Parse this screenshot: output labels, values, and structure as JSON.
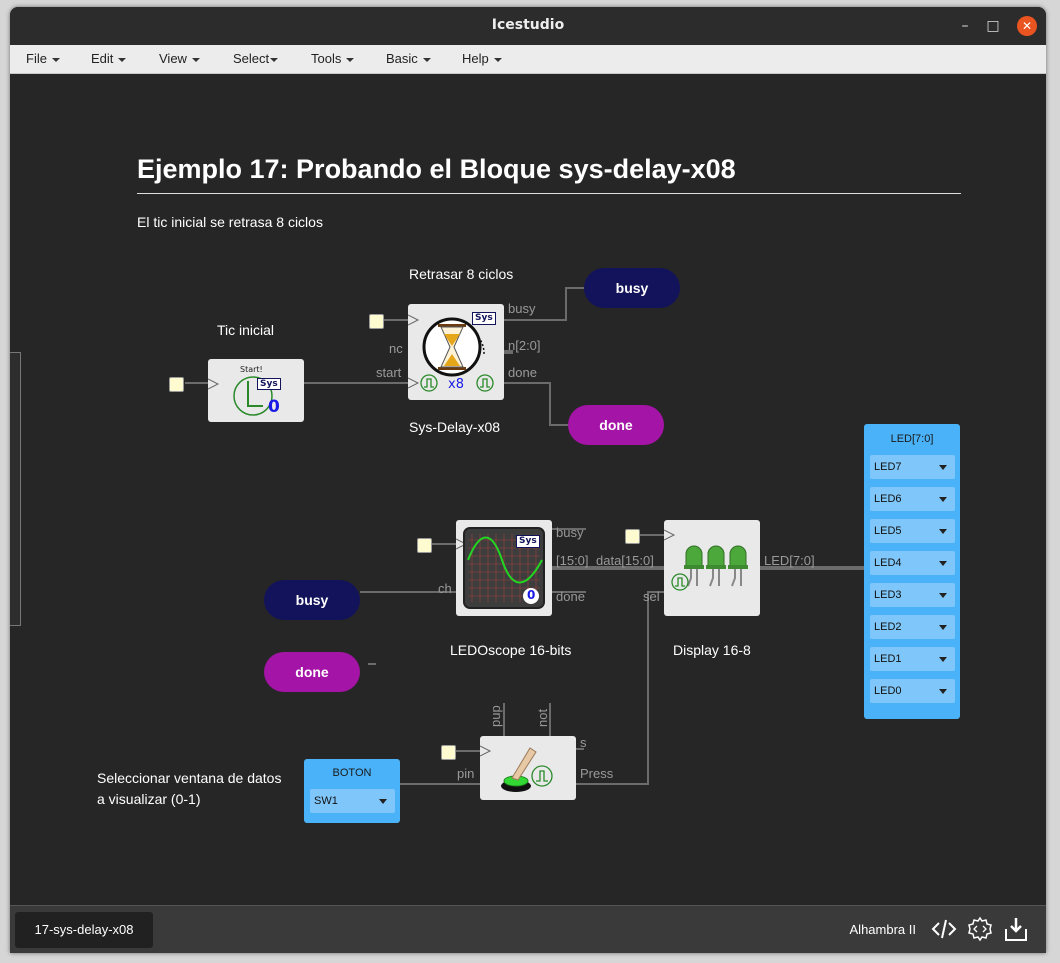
{
  "window": {
    "title": "Icestudio"
  },
  "menu": [
    "File",
    "Edit",
    "View",
    "Select",
    "Tools",
    "Basic",
    "Help"
  ],
  "doc": {
    "heading": "Ejemplo 17: Probando el Bloque sys-delay-x08",
    "subtitle": "El tic inicial se retrasa 8 ciclos",
    "label_retrasar": "Retrasar 8 ciclos",
    "label_tic": "Tic inicial",
    "label_select_1": "Seleccionar ventana de datos",
    "label_select_2": "a visualizar (0-1)"
  },
  "blocks": {
    "start": {
      "top": "Start!",
      "tag": "Sys",
      "value": "0"
    },
    "delay": {
      "name": "Sys-Delay-x08",
      "tag": "Sys",
      "mult": "x8",
      "ports": {
        "busy": "busy",
        "nc": "nc",
        "n": "n[2:0]",
        "start": "start",
        "done": "done"
      }
    },
    "scope": {
      "name": "LEDOscope 16-bits",
      "tag": "Sys",
      "value": "0",
      "ports": {
        "busy": "busy",
        "bus": "[15:0]",
        "ch": "ch",
        "done": "done"
      }
    },
    "display": {
      "name": "Display 16-8",
      "ports": {
        "data": "data[15:0]",
        "sel": "sel",
        "led": "LED[7:0]"
      }
    },
    "button": {
      "ports": {
        "pup": "pup",
        "not": "not",
        "s": "s",
        "pin": "pin",
        "press": "Press"
      }
    }
  },
  "labels": {
    "busy_top": "busy",
    "done_top": "done",
    "busy_left": "busy",
    "done_left": "done"
  },
  "led_panel": {
    "title": "LED[7:0]",
    "items": [
      "LED7",
      "LED6",
      "LED5",
      "LED4",
      "LED3",
      "LED2",
      "LED1",
      "LED0"
    ]
  },
  "boton_panel": {
    "title": "BOTON",
    "value": "SW1"
  },
  "footer": {
    "tab": "17-sys-delay-x08",
    "board": "Alhambra II"
  },
  "colors": {
    "navy": "#13135c",
    "magenta": "#a414a6",
    "panel": "#4ab2f8",
    "accent": "#e95420"
  }
}
